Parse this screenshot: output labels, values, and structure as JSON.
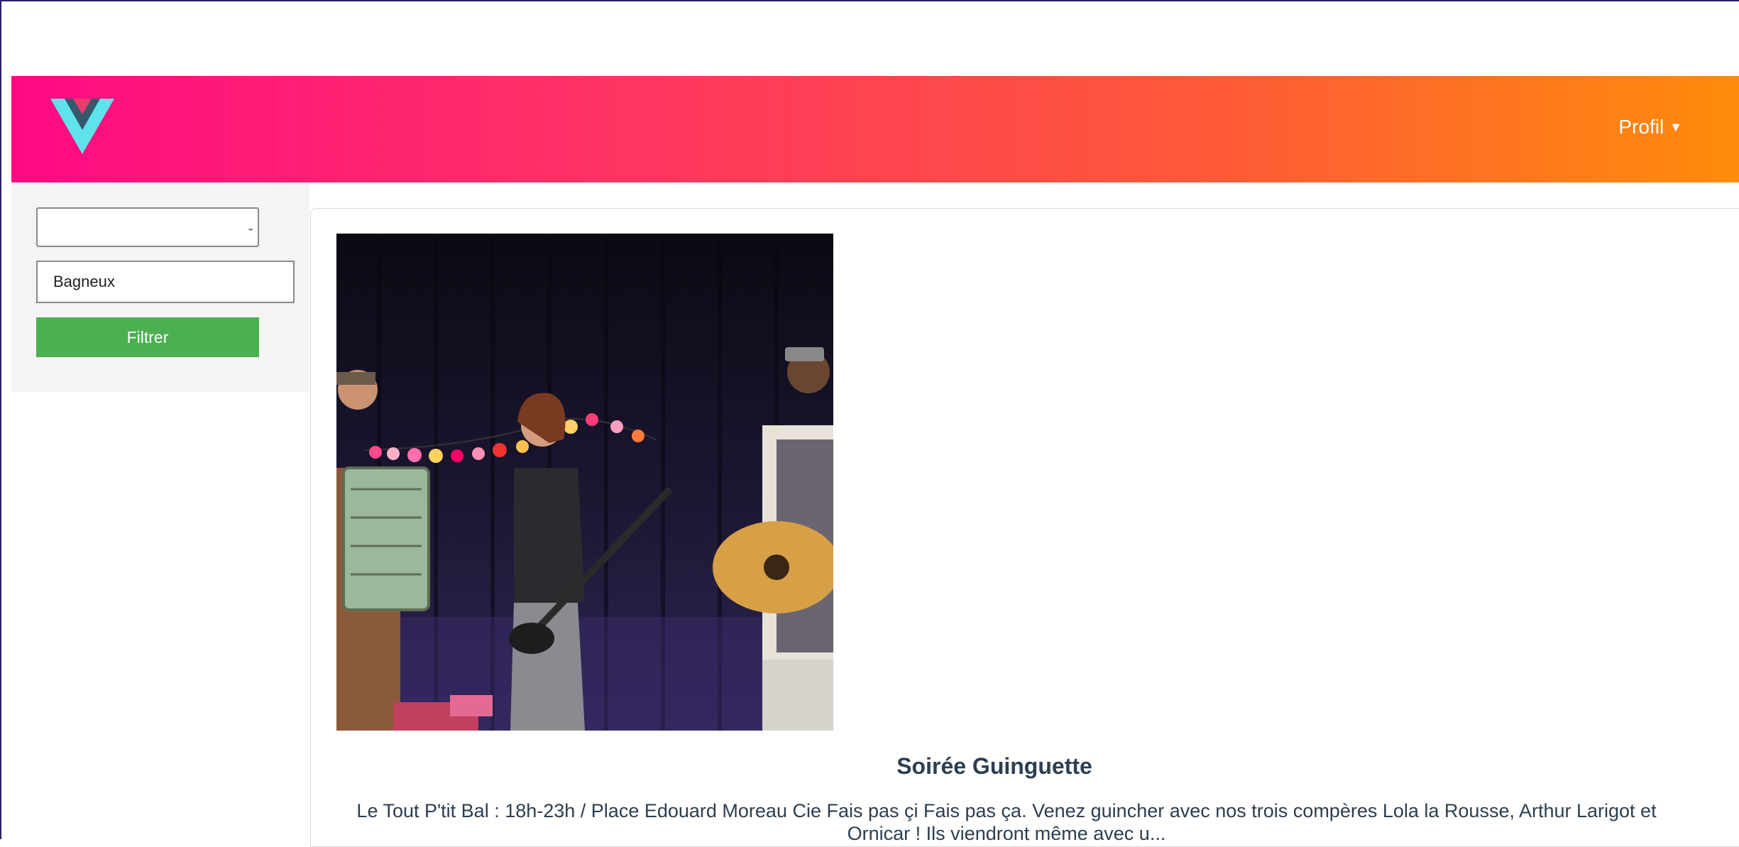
{
  "header": {
    "profile_label": "Profil",
    "profile_caret": "▼",
    "gradient_colors": [
      "#ff0a84",
      "#ff8c0a"
    ]
  },
  "filters": {
    "category_select_value": "",
    "city_input_value": "Bagneux",
    "filter_button_label": "Filtrer",
    "button_color": "#4caf50"
  },
  "event": {
    "title": "Soirée Guinguette",
    "description": "Le Tout P'tit Bal : 18h-23h / Place Edouard Moreau Cie Fais pas çi Fais pas ça. Venez guincher avec nos trois compères Lola la Rousse, Arthur Larigot et Ornicar ! Ils viendront même avec u..."
  }
}
